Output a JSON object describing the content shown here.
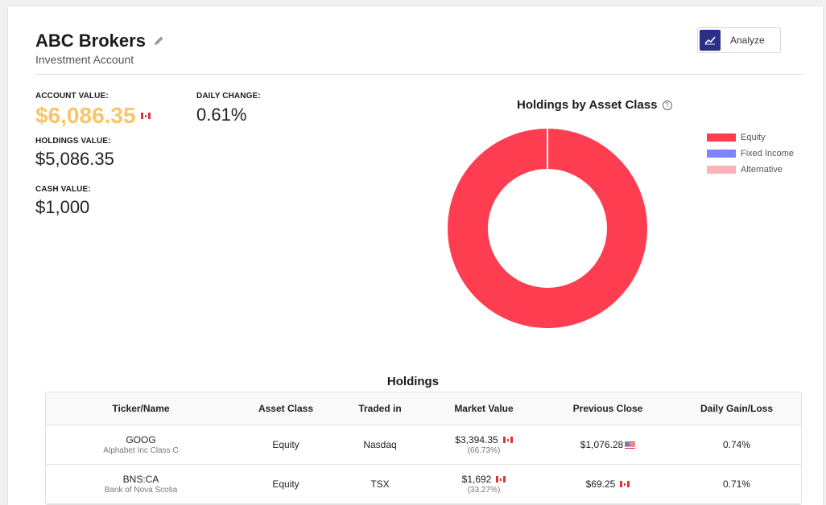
{
  "account": {
    "title": "ABC Brokers",
    "subtitle": "Investment Account",
    "edit_icon": "pencil-icon"
  },
  "toolbar": {
    "analyze_label": "Analyze",
    "analyze_icon": "line-chart-icon"
  },
  "stats": {
    "account_value_label": "ACCOUNT VALUE:",
    "account_value": "$6,086.35",
    "account_value_color": "#f8c56a",
    "daily_change_label": "DAILY CHANGE:",
    "daily_change": "0.61%",
    "holdings_value_label": "HOLDINGS VALUE:",
    "holdings_value": "$5,086.35",
    "cash_value_label": "CASH VALUE:",
    "cash_value": "$1,000"
  },
  "chart": {
    "title": "Holdings by Asset Class",
    "help_symbol": "?"
  },
  "chart_data": {
    "type": "pie",
    "title": "Holdings by Asset Class",
    "categories": [
      "Equity",
      "Fixed Income",
      "Alternative"
    ],
    "values": [
      100,
      0,
      0
    ],
    "colors": [
      "#ff3d50",
      "#7d84ff",
      "#ffb3b8"
    ],
    "legend_position": "top-right",
    "donut": true
  },
  "holdings": {
    "title": "Holdings",
    "columns": [
      "Ticker/Name",
      "Asset Class",
      "Traded in",
      "Market Value",
      "Previous Close",
      "Daily Gain/Loss"
    ],
    "rows": [
      {
        "ticker": "GOOG",
        "name": "Alphabet Inc Class C",
        "asset_class": "Equity",
        "traded_in": "Nasdaq",
        "market_value": "$3,394.35",
        "market_pct": "(66.73%)",
        "market_flag": "ca",
        "prev_close": "$1,076.28",
        "prev_flag": "us",
        "daily_gain": "0.74%"
      },
      {
        "ticker": "BNS:CA",
        "name": "Bank of Nova Scotia",
        "asset_class": "Equity",
        "traded_in": "TSX",
        "market_value": "$1,692",
        "market_pct": "(33.27%)",
        "market_flag": "ca",
        "prev_close": "$69.25",
        "prev_flag": "ca",
        "daily_gain": "0.71%"
      }
    ]
  }
}
